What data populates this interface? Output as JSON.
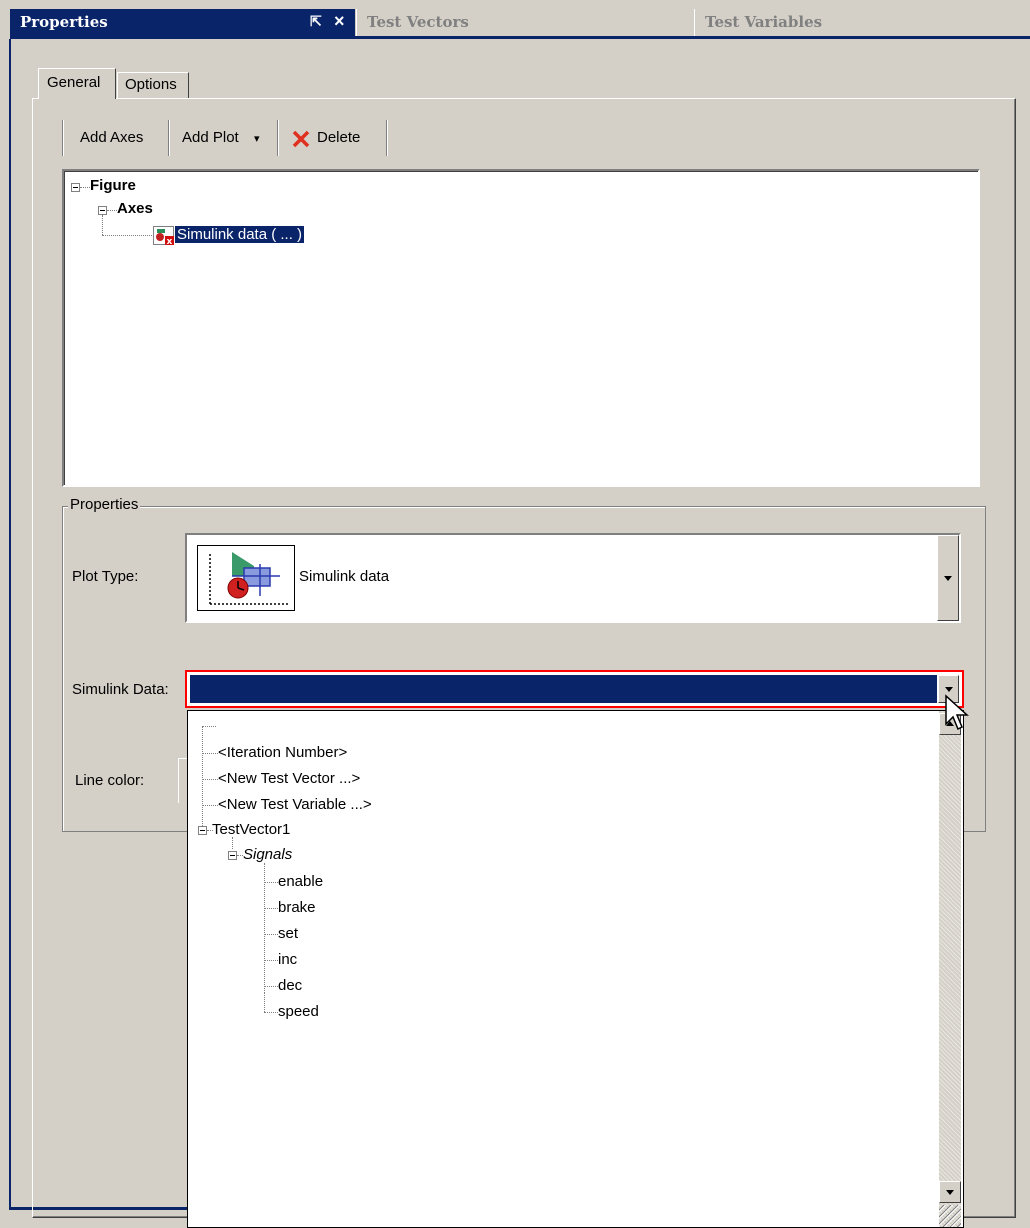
{
  "window_tabs": {
    "properties": "Properties",
    "test_vectors": "Test Vectors",
    "test_variables": "Test Variables",
    "pin_glyph": "⇱",
    "close_glyph": "×"
  },
  "panel_tabs": {
    "general": "General",
    "options": "Options"
  },
  "toolbar": {
    "add_axes": "Add Axes",
    "add_plot": "Add Plot",
    "add_plot_arrow": "▾",
    "delete": "Delete"
  },
  "tree": {
    "figure": "Figure",
    "axes": "Axes",
    "plot_item": "Simulink data ( ... )"
  },
  "properties": {
    "group_label": "Properties",
    "plot_type_label": "Plot Type:",
    "plot_type_value": "Simulink data",
    "simulink_data_label": "Simulink Data:",
    "simulink_data_value": "",
    "line_color_label": "Line color:"
  },
  "dropdown": {
    "items": [
      "<Iteration Number>",
      "<New Test Vector ...>",
      "<New Test Variable ...>",
      "TestVector1",
      "Signals"
    ],
    "signals": [
      "enable",
      "brake",
      "set",
      "inc",
      "dec",
      "speed"
    ]
  },
  "colors": {
    "selection": "#0a246a",
    "face": "#d4d0c8",
    "focus_border": "#ff0000"
  }
}
